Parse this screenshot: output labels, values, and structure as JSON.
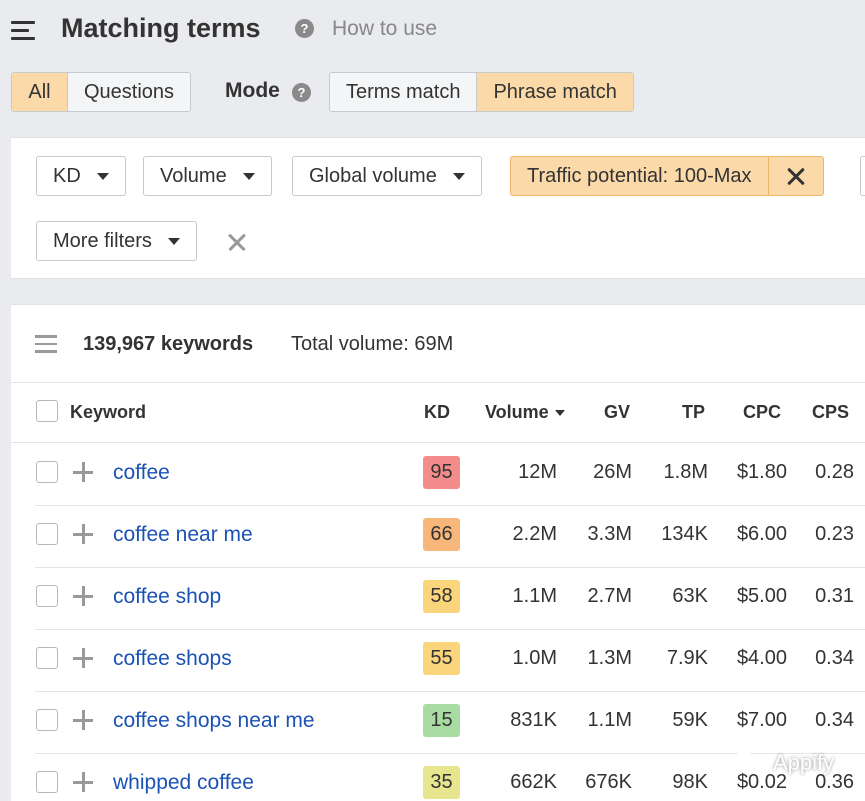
{
  "header": {
    "title": "Matching terms",
    "help_icon": "question-circle-icon",
    "how_to": "How to use"
  },
  "tabs": {
    "items": [
      {
        "label": "All",
        "active": true
      },
      {
        "label": "Questions",
        "active": false
      }
    ]
  },
  "mode": {
    "label": "Mode",
    "options": [
      {
        "label": "Terms match",
        "active": false
      },
      {
        "label": "Phrase match",
        "active": true
      }
    ]
  },
  "filters": {
    "kd": "KD",
    "volume": "Volume",
    "global_volume": "Global volume",
    "traffic_potential": "Traffic potential: 100-Max",
    "more_filters": "More filters"
  },
  "summary": {
    "keywords_count": "139,967 keywords",
    "total_volume": "Total volume: 69M"
  },
  "table": {
    "headers": {
      "keyword": "Keyword",
      "kd": "KD",
      "volume": "Volume",
      "gv": "GV",
      "tp": "TP",
      "cpc": "CPC",
      "cps": "CPS"
    },
    "rows": [
      {
        "keyword": "coffee",
        "kd": "95",
        "kd_color": "#f48c8c",
        "volume": "12M",
        "gv": "26M",
        "tp": "1.8M",
        "cpc": "$1.80",
        "cps": "0.28"
      },
      {
        "keyword": "coffee near me",
        "kd": "66",
        "kd_color": "#f8b77a",
        "volume": "2.2M",
        "gv": "3.3M",
        "tp": "134K",
        "cpc": "$6.00",
        "cps": "0.23"
      },
      {
        "keyword": "coffee shop",
        "kd": "58",
        "kd_color": "#fad57c",
        "volume": "1.1M",
        "gv": "2.7M",
        "tp": "63K",
        "cpc": "$5.00",
        "cps": "0.31"
      },
      {
        "keyword": "coffee shops",
        "kd": "55",
        "kd_color": "#fad57c",
        "volume": "1.0M",
        "gv": "1.3M",
        "tp": "7.9K",
        "cpc": "$4.00",
        "cps": "0.34"
      },
      {
        "keyword": "coffee shops near me",
        "kd": "15",
        "kd_color": "#a9dca3",
        "volume": "831K",
        "gv": "1.1M",
        "tp": "59K",
        "cpc": "$7.00",
        "cps": "0.34"
      },
      {
        "keyword": "whipped coffee",
        "kd": "35",
        "kd_color": "#e8e58f",
        "volume": "662K",
        "gv": "676K",
        "tp": "98K",
        "cpc": "$0.02",
        "cps": "0.36"
      }
    ]
  },
  "watermark": {
    "text": "Appify",
    "icon": "wechat-icon"
  }
}
